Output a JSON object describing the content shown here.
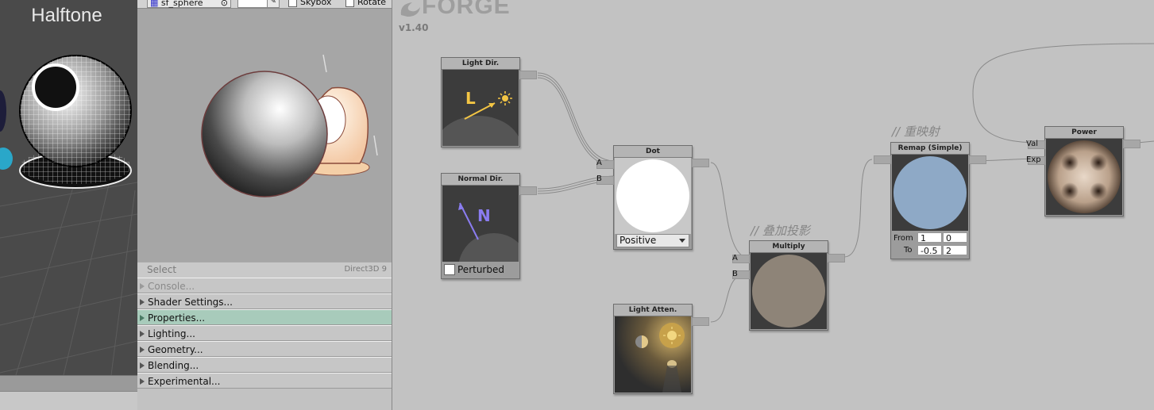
{
  "scene": {
    "title": "Halftone"
  },
  "preview_toolbar": {
    "mesh_value": "sf_sphere",
    "skybox_label": "Skybox",
    "rotate_label": "Rotate"
  },
  "preview_status": {
    "select_label": "Select",
    "api_label": "Direct3D 9"
  },
  "sections": [
    {
      "label": "Console...",
      "state": "disabled"
    },
    {
      "label": "Shader Settings...",
      "state": "normal"
    },
    {
      "label": "Properties...",
      "state": "active"
    },
    {
      "label": "Lighting...",
      "state": "normal"
    },
    {
      "label": "Geometry...",
      "state": "normal"
    },
    {
      "label": "Blending...",
      "state": "normal"
    },
    {
      "label": "Experimental...",
      "state": "normal"
    }
  ],
  "canvas": {
    "logo": "FORGE",
    "version": "v1.40"
  },
  "nodes": {
    "light_dir": {
      "title": "Light Dir.",
      "glyph": "L"
    },
    "normal_dir": {
      "title": "Normal Dir.",
      "glyph": "N",
      "checkbox_label": "Perturbed"
    },
    "dot": {
      "title": "Dot",
      "port_a": "A",
      "port_b": "B",
      "mode": "Positive"
    },
    "light_atten": {
      "title": "Light Atten."
    },
    "multiply": {
      "title": "Multiply",
      "port_a": "A",
      "port_b": "B"
    },
    "remap": {
      "title": "Remap (Simple)",
      "from_label": "From",
      "to_label": "To",
      "from_min": "1",
      "from_max": "0",
      "to_min": "-0.5",
      "to_max": "2"
    },
    "power": {
      "title": "Power",
      "port_val": "Val",
      "port_exp": "Exp"
    }
  },
  "comments": {
    "multiply": "// 叠加投影",
    "remap": "// 重映射"
  },
  "colors": {
    "accent_light": "#f3c544",
    "normal_arrow": "#8a7cf0",
    "remap_fill": "#8ea9c6",
    "multiply_fill": "#8e8478",
    "active_section": "#a8cbbb"
  }
}
